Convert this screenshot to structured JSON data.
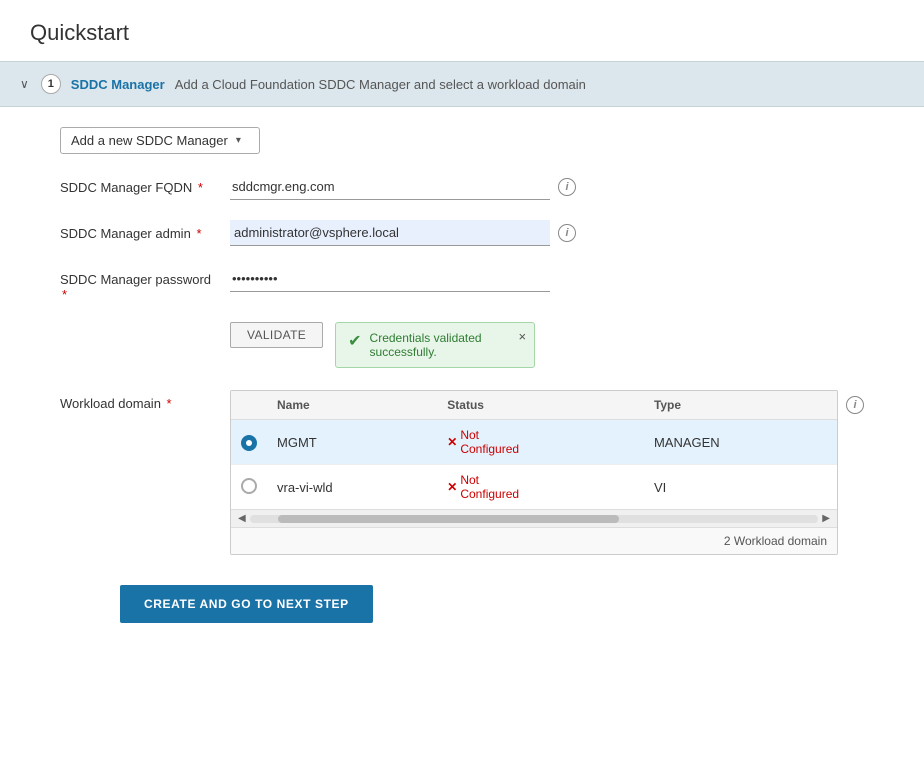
{
  "page": {
    "title": "Quickstart"
  },
  "step_header": {
    "chevron": "∨",
    "number": "1",
    "label": "SDDC Manager",
    "description": "Add a Cloud Foundation SDDC Manager and select a workload domain"
  },
  "form": {
    "dropdown": {
      "label": "Add a new SDDC Manager",
      "arrow": "▾"
    },
    "sddc_fqdn": {
      "label": "SDDC Manager",
      "label2": "FQDN",
      "required": "*",
      "value": "sddcmgr.eng.com",
      "placeholder": ""
    },
    "sddc_admin": {
      "label": "SDDC Manager",
      "label2": "admin",
      "required": "*",
      "value": "administrator@vsphere.local",
      "placeholder": ""
    },
    "sddc_password": {
      "label": "SDDC Manager",
      "label2": "password",
      "required": "*",
      "value": "••••••••••",
      "placeholder": ""
    },
    "validate_button": "VALIDATE",
    "toast": {
      "message": "Credentials validated successfully.",
      "close": "×"
    },
    "workload": {
      "label": "Workload domain",
      "required": "*",
      "info": "i",
      "table": {
        "columns": [
          "",
          "Name",
          "Status",
          "Type"
        ],
        "rows": [
          {
            "selected": true,
            "name": "MGMT",
            "status": "Not Configured",
            "type": "MANAGEN"
          },
          {
            "selected": false,
            "name": "vra-vi-wld",
            "status": "Not Configured",
            "type": "VI"
          }
        ],
        "footer": "2 Workload domain"
      }
    }
  },
  "create_button": "CREATE AND GO TO NEXT STEP"
}
